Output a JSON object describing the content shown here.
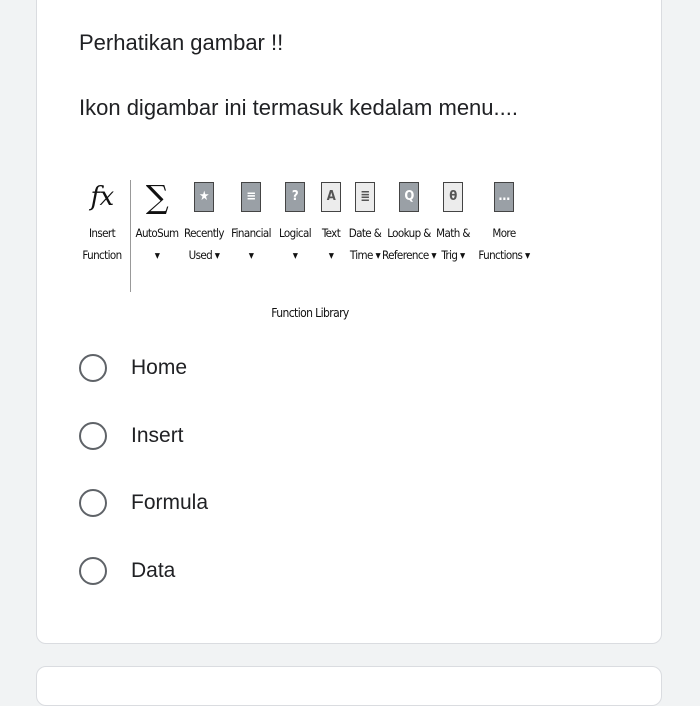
{
  "question": {
    "line1": "Perhatikan gambar !!",
    "line2": "Ikon digambar ini termasuk kedalam menu...."
  },
  "ribbon": {
    "buttons": [
      {
        "icon": "function-fx-icon",
        "glyph": "fx",
        "label1": "Insert",
        "label2": "Function"
      },
      {
        "icon": "autosum-sigma-icon",
        "glyph": "∑",
        "label1": "AutoSum",
        "label2": "▾"
      },
      {
        "icon": "recently-used-star-icon",
        "glyph": "★",
        "label1": "Recently",
        "label2": "Used ▾"
      },
      {
        "icon": "financial-icon",
        "glyph": "≡",
        "label1": "Financial",
        "label2": "▾"
      },
      {
        "icon": "logical-question-icon",
        "glyph": "?",
        "label1": "Logical",
        "label2": "▾"
      },
      {
        "icon": "text-a-icon",
        "glyph": "A",
        "label1": "Text",
        "label2": "▾"
      },
      {
        "icon": "date-time-icon",
        "glyph": "≣",
        "label1": "Date &",
        "label2": "Time ▾"
      },
      {
        "icon": "lookup-reference-icon",
        "glyph": "Q",
        "label1": "Lookup &",
        "label2": "Reference ▾"
      },
      {
        "icon": "math-trig-theta-icon",
        "glyph": "θ",
        "label1": "Math &",
        "label2": "Trig ▾"
      },
      {
        "icon": "more-functions-icon",
        "glyph": "…",
        "label1": "More",
        "label2": "Functions ▾"
      }
    ],
    "group_label": "Function Library"
  },
  "options": [
    {
      "label": "Home"
    },
    {
      "label": "Insert"
    },
    {
      "label": "Formula"
    },
    {
      "label": "Data"
    }
  ]
}
